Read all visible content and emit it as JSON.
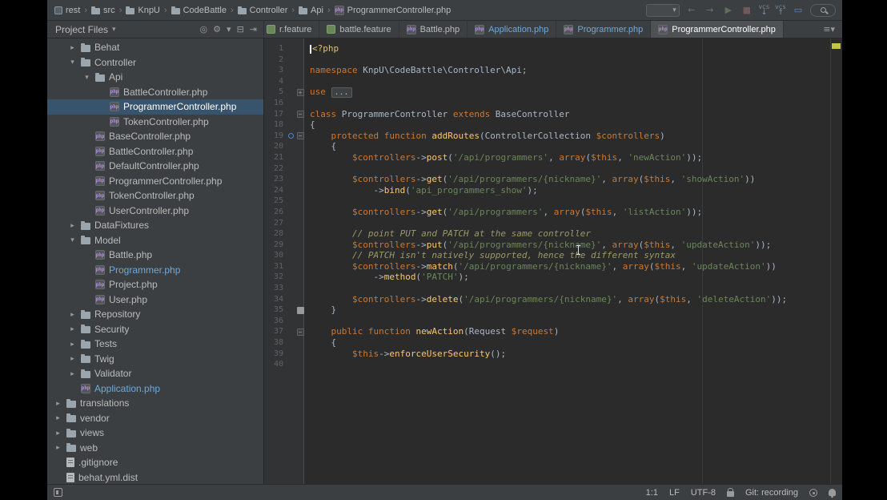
{
  "navbar": {
    "breadcrumbs": [
      {
        "label": "rest",
        "icon": "root"
      },
      {
        "label": "src",
        "icon": "folder"
      },
      {
        "label": "KnpU",
        "icon": "folder"
      },
      {
        "label": "CodeBattle",
        "icon": "folder"
      },
      {
        "label": "Controller",
        "icon": "folder"
      },
      {
        "label": "Api",
        "icon": "folder"
      },
      {
        "label": "ProgrammerController.php",
        "icon": "php"
      }
    ],
    "separator": "›",
    "actions": [
      {
        "name": "run-config-select",
        "type": "combobox",
        "caret": "▾"
      },
      {
        "name": "back-arrow-icon",
        "glyph": "←",
        "color": "#707070"
      },
      {
        "name": "forward-arrow-icon",
        "glyph": "→",
        "color": "#707070"
      },
      {
        "name": "run-icon",
        "glyph": "▶",
        "color": "#5f6f5a"
      },
      {
        "name": "stop-icon",
        "glyph": "■",
        "color": "#6f5a5a"
      },
      {
        "name": "vcs-update-icon",
        "type": "vcs",
        "label": "VCS",
        "glyph": "↓",
        "color": "#7b93ab"
      },
      {
        "name": "vcs-commit-icon",
        "type": "vcs",
        "label": "VCS",
        "glyph": "↑",
        "color": "#7b93ab"
      },
      {
        "name": "screen-share-icon",
        "glyph": "▭",
        "color": "#5f87c7"
      },
      {
        "name": "search-icon",
        "type": "search"
      }
    ]
  },
  "project_panel": {
    "title": "Project Files",
    "title_caret": "▾",
    "toolbar": [
      {
        "name": "locate-icon",
        "glyph": "◎"
      },
      {
        "name": "settings-gear-icon",
        "glyph": "⚙"
      },
      {
        "name": "gear-dropdown-icon",
        "glyph": "▾"
      },
      {
        "name": "collapse-all-icon",
        "glyph": "⊟"
      },
      {
        "name": "hide-panel-icon",
        "glyph": "⇥"
      }
    ],
    "tree": [
      {
        "label": "Behat",
        "type": "folder",
        "level": 1,
        "arrow": "right"
      },
      {
        "label": "Controller",
        "type": "folder",
        "level": 1,
        "arrow": "down"
      },
      {
        "label": "Api",
        "type": "folder",
        "level": 2,
        "arrow": "down"
      },
      {
        "label": "BattleController.php",
        "type": "php",
        "level": 3
      },
      {
        "label": "ProgrammerController.php",
        "type": "php",
        "level": 3,
        "selected": true
      },
      {
        "label": "TokenController.php",
        "type": "php",
        "level": 3
      },
      {
        "label": "BaseController.php",
        "type": "php",
        "level": 2
      },
      {
        "label": "BattleController.php",
        "type": "php",
        "level": 2
      },
      {
        "label": "DefaultController.php",
        "type": "php",
        "level": 2
      },
      {
        "label": "ProgrammerController.php",
        "type": "php",
        "level": 2
      },
      {
        "label": "TokenController.php",
        "type": "php",
        "level": 2
      },
      {
        "label": "UserController.php",
        "type": "php",
        "level": 2
      },
      {
        "label": "DataFixtures",
        "type": "folder",
        "level": 1,
        "arrow": "right"
      },
      {
        "label": "Model",
        "type": "folder",
        "level": 1,
        "arrow": "down"
      },
      {
        "label": "Battle.php",
        "type": "php",
        "level": 2
      },
      {
        "label": "Programmer.php",
        "type": "php",
        "level": 2,
        "mod": true
      },
      {
        "label": "Project.php",
        "type": "php",
        "level": 2
      },
      {
        "label": "User.php",
        "type": "php",
        "level": 2
      },
      {
        "label": "Repository",
        "type": "folder",
        "level": 1,
        "arrow": "right"
      },
      {
        "label": "Security",
        "type": "folder",
        "level": 1,
        "arrow": "right"
      },
      {
        "label": "Tests",
        "type": "folder",
        "level": 1,
        "arrow": "right"
      },
      {
        "label": "Twig",
        "type": "folder",
        "level": 1,
        "arrow": "right"
      },
      {
        "label": "Validator",
        "type": "folder",
        "level": 1,
        "arrow": "right"
      },
      {
        "label": "Application.php",
        "type": "php",
        "level": 1,
        "mod": true
      },
      {
        "label": "translations",
        "type": "folder",
        "level": 0,
        "arrow": "right"
      },
      {
        "label": "vendor",
        "type": "folder",
        "level": 0,
        "arrow": "right"
      },
      {
        "label": "views",
        "type": "folder",
        "level": 0,
        "arrow": "right"
      },
      {
        "label": "web",
        "type": "folder",
        "level": 0,
        "arrow": "right"
      },
      {
        "label": ".gitignore",
        "type": "text",
        "level": 0
      },
      {
        "label": "behat.yml.dist",
        "type": "text",
        "level": 0
      }
    ]
  },
  "tabs": [
    {
      "label": "r.feature",
      "kind": "feature",
      "clip": true
    },
    {
      "label": "battle.feature",
      "kind": "feature"
    },
    {
      "label": "Battle.php",
      "kind": "php"
    },
    {
      "label": "Application.php",
      "kind": "php",
      "mod": true
    },
    {
      "label": "Programmer.php",
      "kind": "php",
      "mod": true
    },
    {
      "label": "ProgrammerController.php",
      "kind": "php",
      "active": true
    }
  ],
  "tabs_meta": {
    "list_glyph": "≡▾"
  },
  "editor": {
    "lines": [
      {
        "n": "1",
        "caret": true,
        "seg": [
          [
            "t",
            "<?php"
          ]
        ]
      },
      {
        "n": "2",
        "seg": []
      },
      {
        "n": "3",
        "seg": [
          [
            "k",
            "namespace"
          ],
          [
            "p",
            " KnpU\\CodeBattle\\Controller\\Api;"
          ]
        ]
      },
      {
        "n": "4",
        "seg": []
      },
      {
        "n": "5",
        "fold": "+",
        "seg": [
          [
            "k",
            "use"
          ],
          [
            "p",
            " "
          ],
          [
            "d",
            "..."
          ]
        ]
      },
      {
        "n": "16",
        "seg": []
      },
      {
        "n": "17",
        "fold": "-",
        "seg": [
          [
            "k",
            "class"
          ],
          [
            "p",
            " ProgrammerController "
          ],
          [
            "k",
            "extends"
          ],
          [
            "p",
            " BaseController"
          ]
        ]
      },
      {
        "n": "18",
        "seg": [
          [
            "p",
            "{"
          ]
        ]
      },
      {
        "n": "19",
        "fold": "-",
        "ovr": true,
        "seg": [
          [
            "p",
            "    "
          ],
          [
            "k",
            "protected"
          ],
          [
            "p",
            " "
          ],
          [
            "k",
            "function"
          ],
          [
            "p",
            " "
          ],
          [
            "f",
            "addRoutes"
          ],
          [
            "p",
            "(ControllerCollection "
          ],
          [
            "v",
            "$controllers"
          ],
          [
            "p",
            ")"
          ]
        ]
      },
      {
        "n": "20",
        "seg": [
          [
            "p",
            "    {"
          ]
        ]
      },
      {
        "n": "21",
        "seg": [
          [
            "p",
            "        "
          ],
          [
            "v",
            "$controllers"
          ],
          [
            "p",
            "->"
          ],
          [
            "f",
            "post"
          ],
          [
            "p",
            "("
          ],
          [
            "s",
            "'/api/programmers'"
          ],
          [
            "p",
            ", "
          ],
          [
            "k",
            "array"
          ],
          [
            "p",
            "("
          ],
          [
            "v",
            "$this"
          ],
          [
            "p",
            ", "
          ],
          [
            "s",
            "'newAction'"
          ],
          [
            "p",
            "));"
          ]
        ]
      },
      {
        "n": "22",
        "seg": []
      },
      {
        "n": "23",
        "seg": [
          [
            "p",
            "        "
          ],
          [
            "v",
            "$controllers"
          ],
          [
            "p",
            "->"
          ],
          [
            "f",
            "get"
          ],
          [
            "p",
            "("
          ],
          [
            "s",
            "'/api/programmers/{nickname}'"
          ],
          [
            "p",
            ", "
          ],
          [
            "k",
            "array"
          ],
          [
            "p",
            "("
          ],
          [
            "v",
            "$this"
          ],
          [
            "p",
            ", "
          ],
          [
            "s",
            "'showAction'"
          ],
          [
            "p",
            "))"
          ]
        ]
      },
      {
        "n": "24",
        "seg": [
          [
            "p",
            "            ->"
          ],
          [
            "f",
            "bind"
          ],
          [
            "p",
            "("
          ],
          [
            "s",
            "'api_programmers_show'"
          ],
          [
            "p",
            ");"
          ]
        ]
      },
      {
        "n": "25",
        "seg": []
      },
      {
        "n": "26",
        "seg": [
          [
            "p",
            "        "
          ],
          [
            "v",
            "$controllers"
          ],
          [
            "p",
            "->"
          ],
          [
            "f",
            "get"
          ],
          [
            "p",
            "("
          ],
          [
            "s",
            "'/api/programmers'"
          ],
          [
            "p",
            ", "
          ],
          [
            "k",
            "array"
          ],
          [
            "p",
            "("
          ],
          [
            "v",
            "$this"
          ],
          [
            "p",
            ", "
          ],
          [
            "s",
            "'listAction'"
          ],
          [
            "p",
            "));"
          ]
        ]
      },
      {
        "n": "27",
        "seg": []
      },
      {
        "n": "28",
        "seg": [
          [
            "p",
            "        "
          ],
          [
            "c",
            "// point PUT and PATCH at the same controller"
          ]
        ]
      },
      {
        "n": "29",
        "seg": [
          [
            "p",
            "        "
          ],
          [
            "v",
            "$controllers"
          ],
          [
            "p",
            "->"
          ],
          [
            "f",
            "put"
          ],
          [
            "p",
            "("
          ],
          [
            "s",
            "'/api/programmers/{nickname}'"
          ],
          [
            "p",
            ", "
          ],
          [
            "k",
            "array"
          ],
          [
            "p",
            "("
          ],
          [
            "v",
            "$this"
          ],
          [
            "p",
            ", "
          ],
          [
            "s",
            "'updateAction'"
          ],
          [
            "p",
            "));"
          ]
        ]
      },
      {
        "n": "30",
        "seg": [
          [
            "p",
            "        "
          ],
          [
            "c",
            "// PATCH isn't natively supported, hence the different syntax"
          ]
        ]
      },
      {
        "n": "31",
        "seg": [
          [
            "p",
            "        "
          ],
          [
            "v",
            "$controllers"
          ],
          [
            "p",
            "->"
          ],
          [
            "f",
            "match"
          ],
          [
            "p",
            "("
          ],
          [
            "s",
            "'/api/programmers/{nickname}'"
          ],
          [
            "p",
            ", "
          ],
          [
            "k",
            "array"
          ],
          [
            "p",
            "("
          ],
          [
            "v",
            "$this"
          ],
          [
            "p",
            ", "
          ],
          [
            "s",
            "'updateAction'"
          ],
          [
            "p",
            "))"
          ]
        ]
      },
      {
        "n": "32",
        "seg": [
          [
            "p",
            "            ->"
          ],
          [
            "f",
            "method"
          ],
          [
            "p",
            "("
          ],
          [
            "s",
            "'PATCH'"
          ],
          [
            "p",
            ");"
          ]
        ]
      },
      {
        "n": "33",
        "seg": []
      },
      {
        "n": "34",
        "seg": [
          [
            "p",
            "        "
          ],
          [
            "v",
            "$controllers"
          ],
          [
            "p",
            "->"
          ],
          [
            "f",
            "delete"
          ],
          [
            "p",
            "("
          ],
          [
            "s",
            "'/api/programmers/{nickname}'"
          ],
          [
            "p",
            ", "
          ],
          [
            "k",
            "array"
          ],
          [
            "p",
            "("
          ],
          [
            "v",
            "$this"
          ],
          [
            "p",
            ", "
          ],
          [
            "s",
            "'deleteAction'"
          ],
          [
            "p",
            "));"
          ]
        ]
      },
      {
        "n": "35",
        "fold": "e",
        "seg": [
          [
            "p",
            "    }"
          ]
        ]
      },
      {
        "n": "36",
        "seg": []
      },
      {
        "n": "37",
        "fold": "-",
        "seg": [
          [
            "p",
            "    "
          ],
          [
            "k",
            "public"
          ],
          [
            "p",
            " "
          ],
          [
            "k",
            "function"
          ],
          [
            "p",
            " "
          ],
          [
            "f",
            "newAction"
          ],
          [
            "p",
            "(Request "
          ],
          [
            "v",
            "$request"
          ],
          [
            "p",
            ")"
          ]
        ]
      },
      {
        "n": "38",
        "seg": [
          [
            "p",
            "    {"
          ]
        ]
      },
      {
        "n": "39",
        "seg": [
          [
            "p",
            "        "
          ],
          [
            "v",
            "$this"
          ],
          [
            "p",
            "->"
          ],
          [
            "f",
            "enforceUserSecurity"
          ],
          [
            "p",
            "();"
          ]
        ]
      },
      {
        "n": "40",
        "seg": []
      }
    ]
  },
  "status_bar": {
    "position": "1:1",
    "line_ending": "LF",
    "encoding": "UTF-8",
    "git": "Git: recording"
  }
}
